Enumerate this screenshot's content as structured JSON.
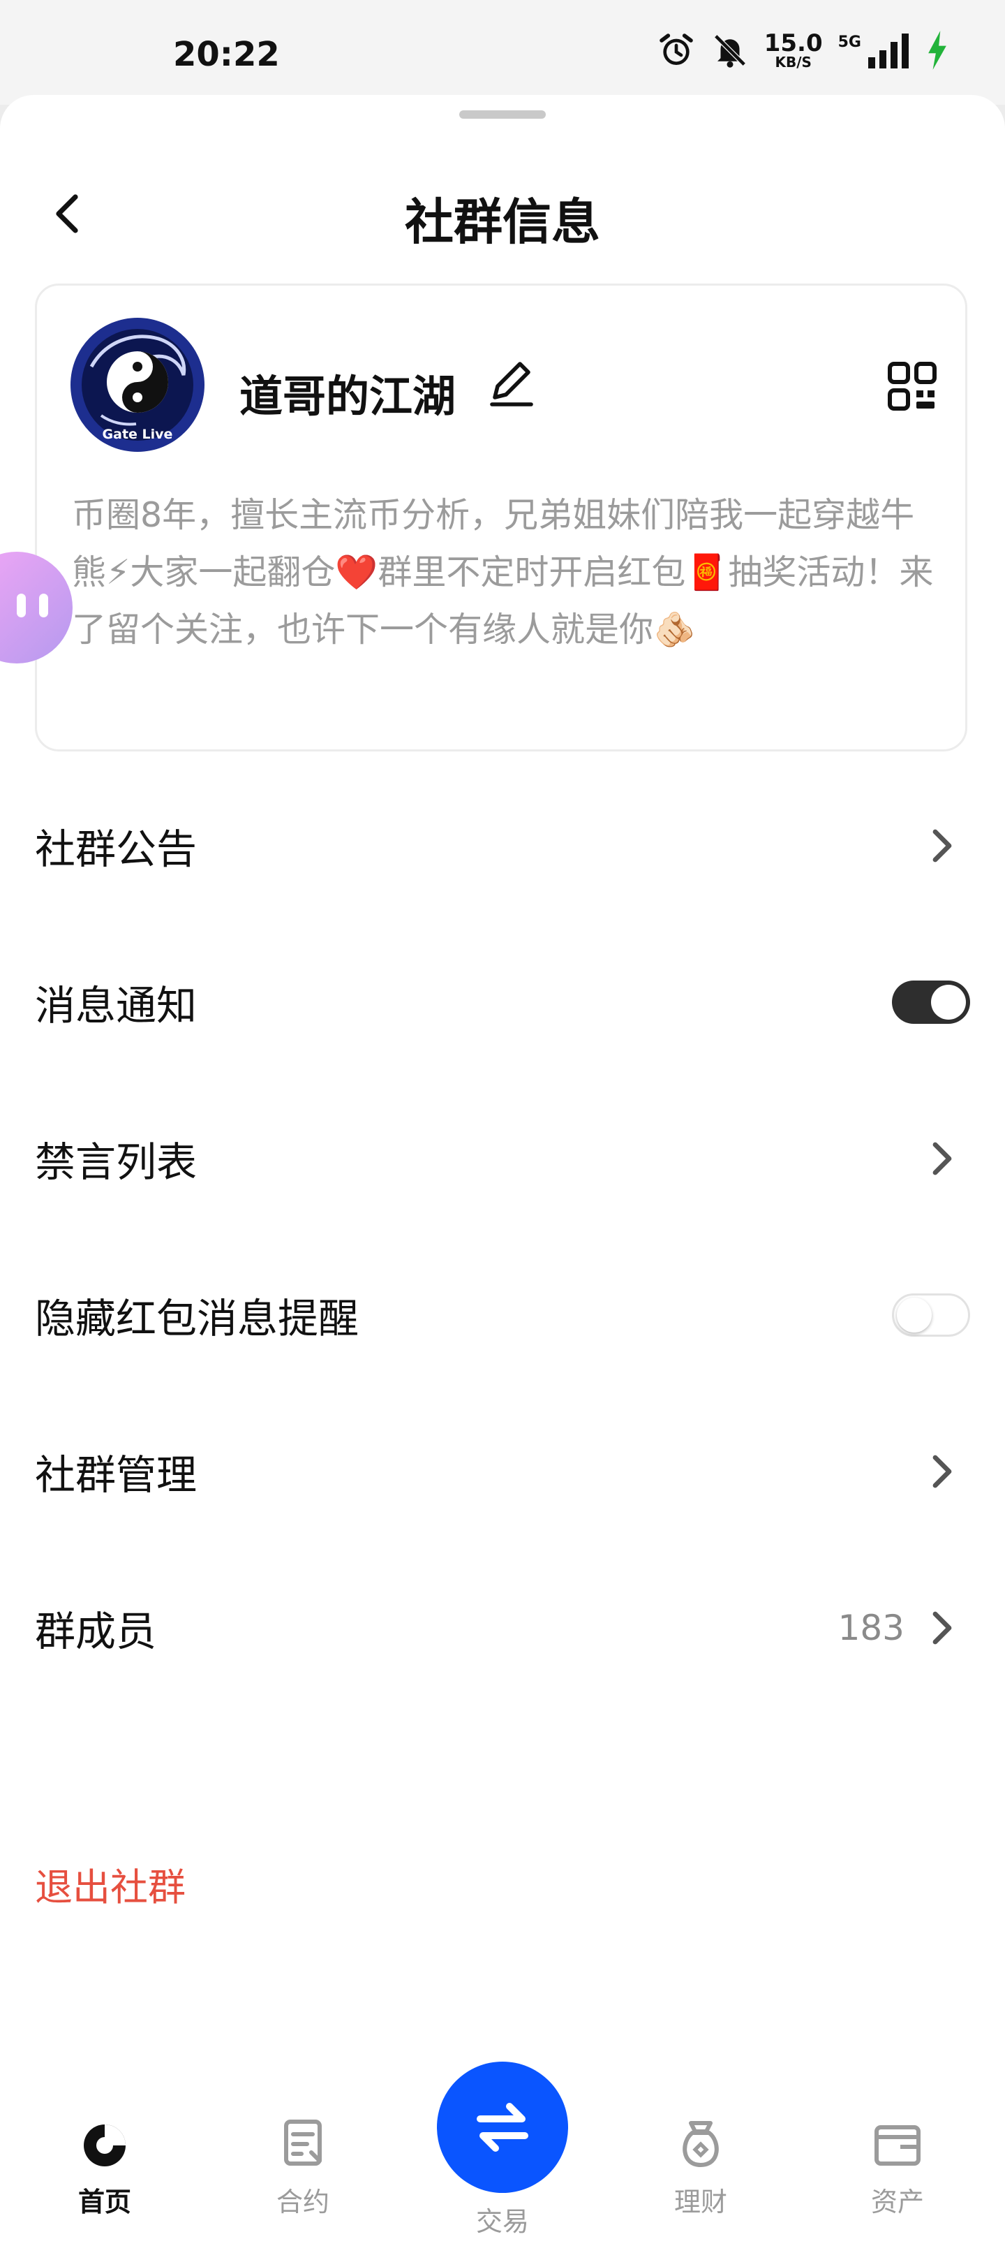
{
  "status": {
    "time": "20:22",
    "net_speed_value": "15.0",
    "net_speed_unit": "KB/S",
    "network": "5G"
  },
  "header": {
    "title": "社群信息"
  },
  "group": {
    "name": "道哥的江湖",
    "avatar_caption": "Gate Live",
    "description": "币圈8年，擅长主流币分析，兄弟姐妹们陪我一起穿越牛熊⚡大家一起翻仓❤️群里不定时开启红包🧧抽奖活动！来了留个关注，也许下一个有缘人就是你🫵🏻"
  },
  "settings": {
    "announcement": "社群公告",
    "notifications": "消息通知",
    "notifications_on": true,
    "mute_list": "禁言列表",
    "hide_redpacket": "隐藏红包消息提醒",
    "hide_redpacket_on": false,
    "management": "社群管理",
    "members": "群成员",
    "member_count": "183",
    "exit": "退出社群"
  },
  "tabs": [
    {
      "label": "首页",
      "icon": "home-icon",
      "active": true
    },
    {
      "label": "合约",
      "icon": "contract-icon",
      "active": false
    },
    {
      "label": "交易",
      "icon": "trade-icon",
      "active": false
    },
    {
      "label": "理财",
      "icon": "finance-icon",
      "active": false
    },
    {
      "label": "资产",
      "icon": "wallet-icon",
      "active": false
    }
  ],
  "colors": {
    "accent_blue": "#0a55ff",
    "danger_red": "#e64f3f",
    "charging_green": "#22b33a",
    "toggle_on": "#2e2e2e"
  }
}
